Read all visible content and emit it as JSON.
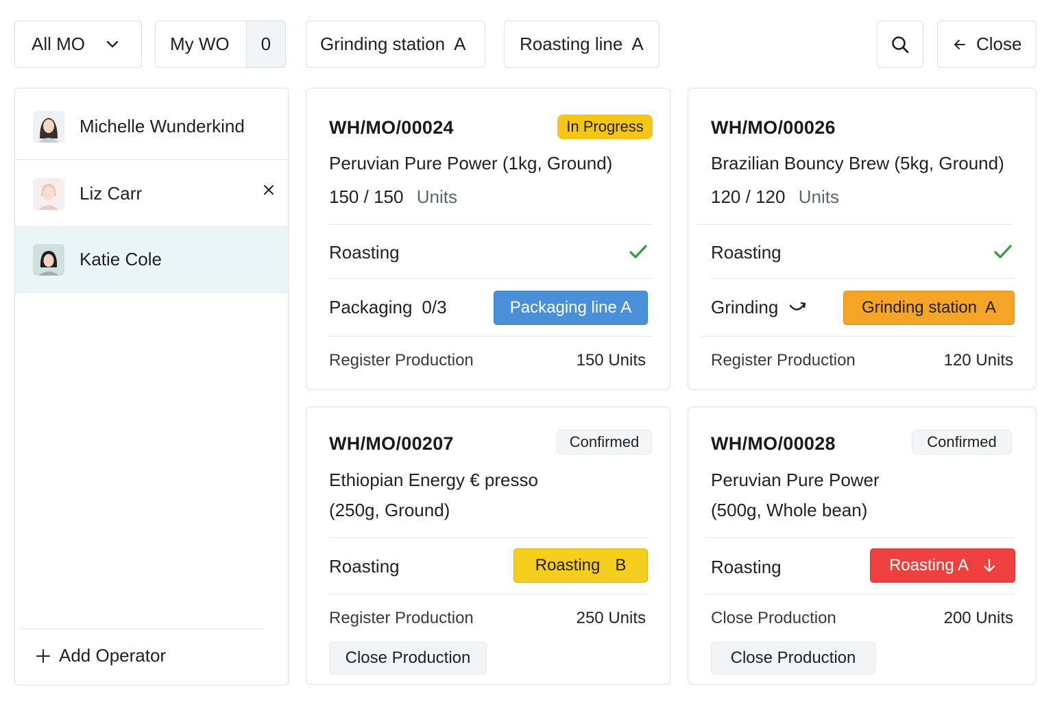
{
  "toolbar": {
    "filter_label": "All MO",
    "my_wo_label": "My WO",
    "my_wo_count": "0",
    "workcenter_1": "Grinding station  A",
    "workcenter_2": "Roasting line  A",
    "close_label": "Close"
  },
  "operators": {
    "items": [
      {
        "name": "Michelle Wunderkind",
        "selected": false,
        "removable": false
      },
      {
        "name": "Liz Carr",
        "selected": false,
        "removable": true
      },
      {
        "name": "Katie Cole",
        "selected": true,
        "removable": false
      }
    ],
    "add_label": "Add Operator"
  },
  "cards": [
    {
      "ref": "WH/MO/00024",
      "status": "In Progress",
      "product": "Peruvian Pure Power (1kg, Ground)",
      "qty_done": "150",
      "qty_total": "150",
      "qty_sep": "/",
      "unit": "Units",
      "step1_label": "Roasting",
      "step2_label": "Packaging",
      "step2_progress": "0/3",
      "step2_workcenter": "Packaging line A",
      "action_label": "Register Production",
      "action_value": "150 Units"
    },
    {
      "ref": "WH/MO/00026",
      "status": "",
      "product": "Brazilian Bouncy Brew (5kg, Ground)",
      "qty_done": "120",
      "qty_total": "120",
      "qty_sep": "/",
      "unit": "Units",
      "step1_label": "Roasting",
      "step2_label": "Grinding",
      "step2_workcenter": "Grinding station  A",
      "action_label": "Register Production",
      "action_value": "120 Units"
    },
    {
      "ref": "WH/MO/00207",
      "status": "Confirmed",
      "product_line1": "Ethiopian Energy € presso",
      "product_line2": "(250g, Ground)",
      "step1_label": "Roasting",
      "step1_workcenter": "Roasting",
      "step1_workcenter_suffix": "B",
      "action_label": "Register Production",
      "action_value": "250 Units",
      "close_button": "Close Production"
    },
    {
      "ref": "WH/MO/00028",
      "status": "Confirmed",
      "product_line1": "Peruvian Pure Power",
      "product_line2": "(500g, Whole bean)",
      "step1_label": "Roasting",
      "step1_workcenter": "Roasting A",
      "action_label": "Close Production",
      "action_value": "200 Units",
      "close_button": "Close Production"
    }
  ],
  "colors": {
    "in_progress": "#f5c518",
    "packaging_line": "#4a90d9",
    "grinding_station": "#f5a425",
    "roasting_b": "#f5cd1c",
    "roasting_a": "#ef4040",
    "check": "#2e9e3a",
    "selected_row": "#eaf5f8"
  }
}
